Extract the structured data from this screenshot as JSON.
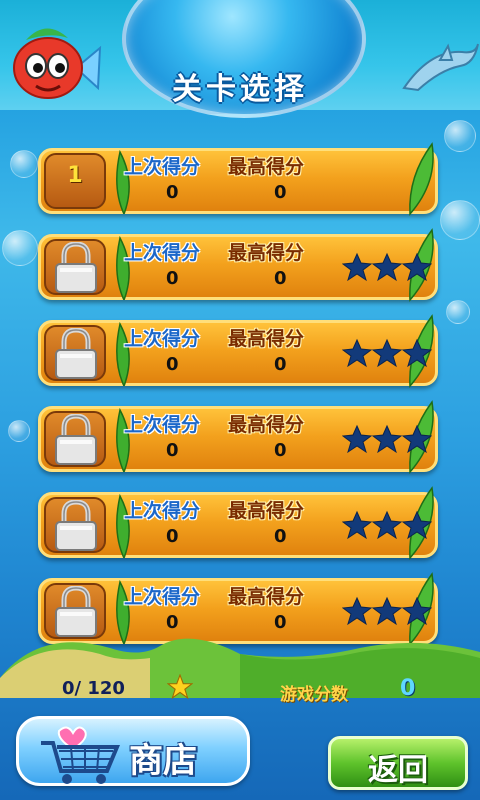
{
  "header": {
    "title": "关卡选择"
  },
  "levels": [
    {
      "number": "1",
      "locked": false,
      "last_label": "上次得分",
      "best_label": "最高得分",
      "last_score": "0",
      "best_score": "0",
      "stars_shown": false
    },
    {
      "number": "",
      "locked": true,
      "last_label": "上次得分",
      "best_label": "最高得分",
      "last_score": "0",
      "best_score": "0",
      "stars_shown": true
    },
    {
      "number": "",
      "locked": true,
      "last_label": "上次得分",
      "best_label": "最高得分",
      "last_score": "0",
      "best_score": "0",
      "stars_shown": true
    },
    {
      "number": "",
      "locked": true,
      "last_label": "上次得分",
      "best_label": "最高得分",
      "last_score": "0",
      "best_score": "0",
      "stars_shown": true
    },
    {
      "number": "",
      "locked": true,
      "last_label": "上次得分",
      "best_label": "最高得分",
      "last_score": "0",
      "best_score": "0",
      "stars_shown": true
    },
    {
      "number": "",
      "locked": true,
      "last_label": "上次得分",
      "best_label": "最高得分",
      "last_score": "0",
      "best_score": "0",
      "stars_shown": true
    }
  ],
  "hud": {
    "stars_collected": "0/ 120",
    "game_score_label": "游戏分数",
    "game_score_value": "0"
  },
  "buttons": {
    "shop_label": "商店",
    "back_label": "返回"
  },
  "icons": {
    "lock": "lock-icon",
    "star": "star-icon",
    "cart": "shopping-cart-icon"
  },
  "colors": {
    "row_orange": "#f3a11d",
    "star_navy": "#123a7a",
    "back_green": "#5fc32c"
  }
}
